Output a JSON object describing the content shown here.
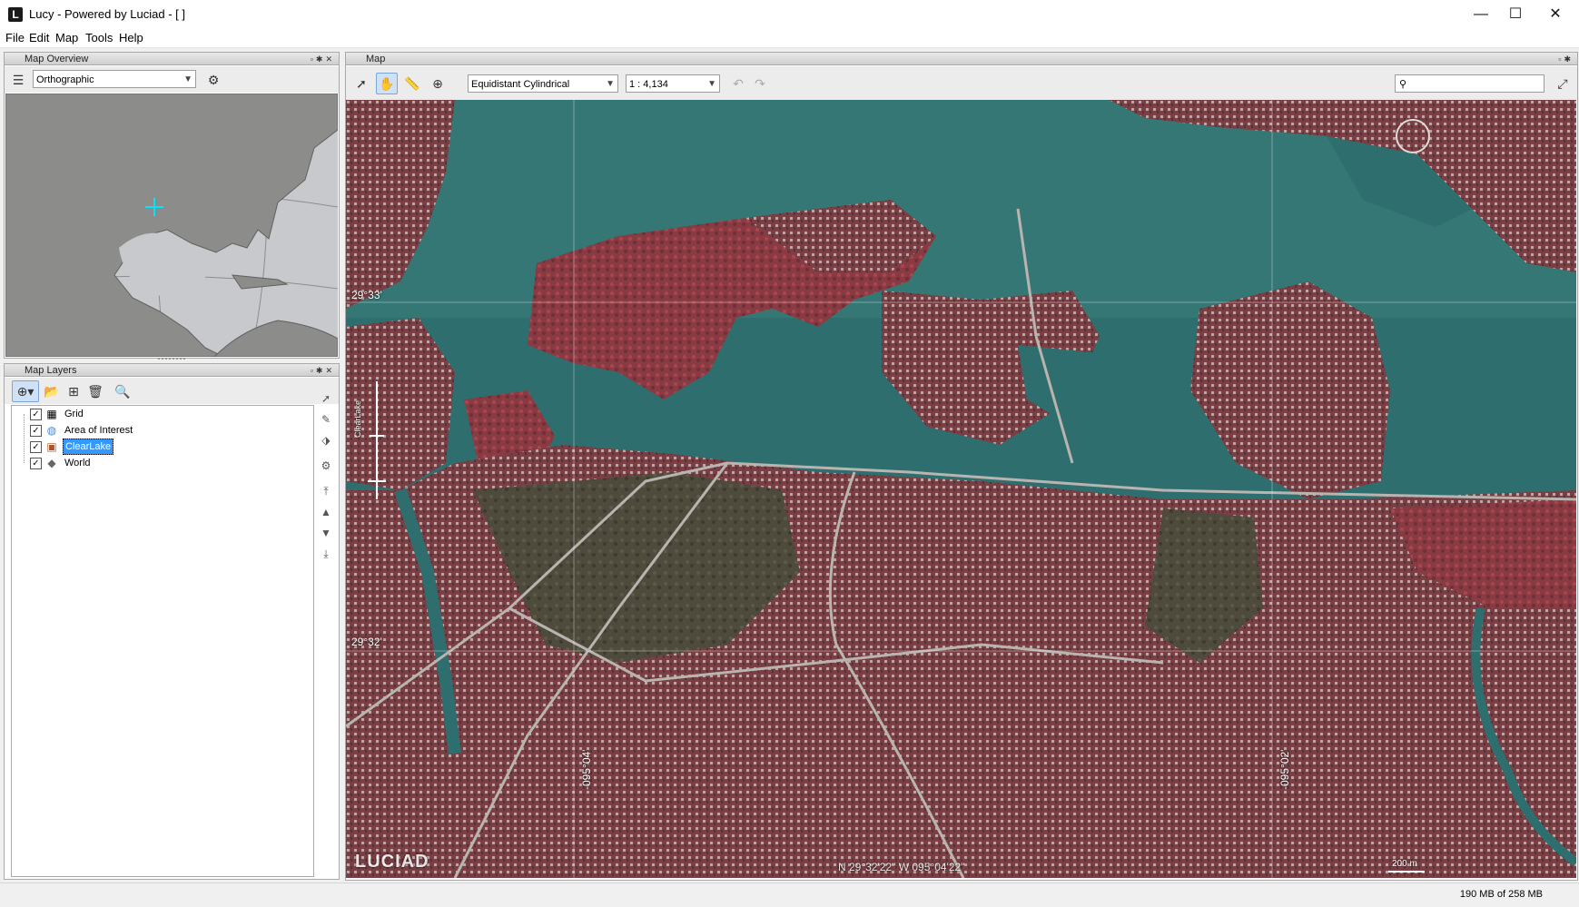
{
  "window": {
    "title": "Lucy - Powered by Luciad - [ ]",
    "logo_letter": "L",
    "minimize": "—",
    "maximize": "☐",
    "close": "✕"
  },
  "menu": {
    "items": [
      "File",
      "Edit",
      "Map",
      "Tools",
      "Help"
    ]
  },
  "overview_panel": {
    "title": "Map Overview",
    "projection": "Orthographic"
  },
  "layers_panel": {
    "title": "Map Layers",
    "layers": [
      {
        "name": "Grid",
        "checked": true,
        "icon": "grid-icon"
      },
      {
        "name": "Area of Interest",
        "checked": true,
        "icon": "area-of-interest-icon"
      },
      {
        "name": "ClearLake",
        "checked": true,
        "icon": "raster-image-icon",
        "selected": true
      },
      {
        "name": "World",
        "checked": true,
        "icon": "world-shape-icon"
      }
    ]
  },
  "map_panel": {
    "title": "Map",
    "projection": "Equidistant Cylindrical",
    "scale": "1 : 4,134",
    "search_placeholder": ""
  },
  "map": {
    "lat_labels": [
      "29°33'",
      "29°32'"
    ],
    "lon_labels": [
      "-095°04'",
      "-095°02'"
    ],
    "cursor_coordinates": "N 29°32'22\" W 095°04'22\"",
    "scale_bar": "200 m",
    "watermark": "LUCIAD",
    "slider_label": "ClearLake"
  },
  "status": {
    "memory": "190 MB of 258 MB"
  },
  "colors": {
    "selection": "#3399ff",
    "crosshair": "#00e5ff",
    "water": "#2f6e6e",
    "land": "#7a3f44"
  }
}
